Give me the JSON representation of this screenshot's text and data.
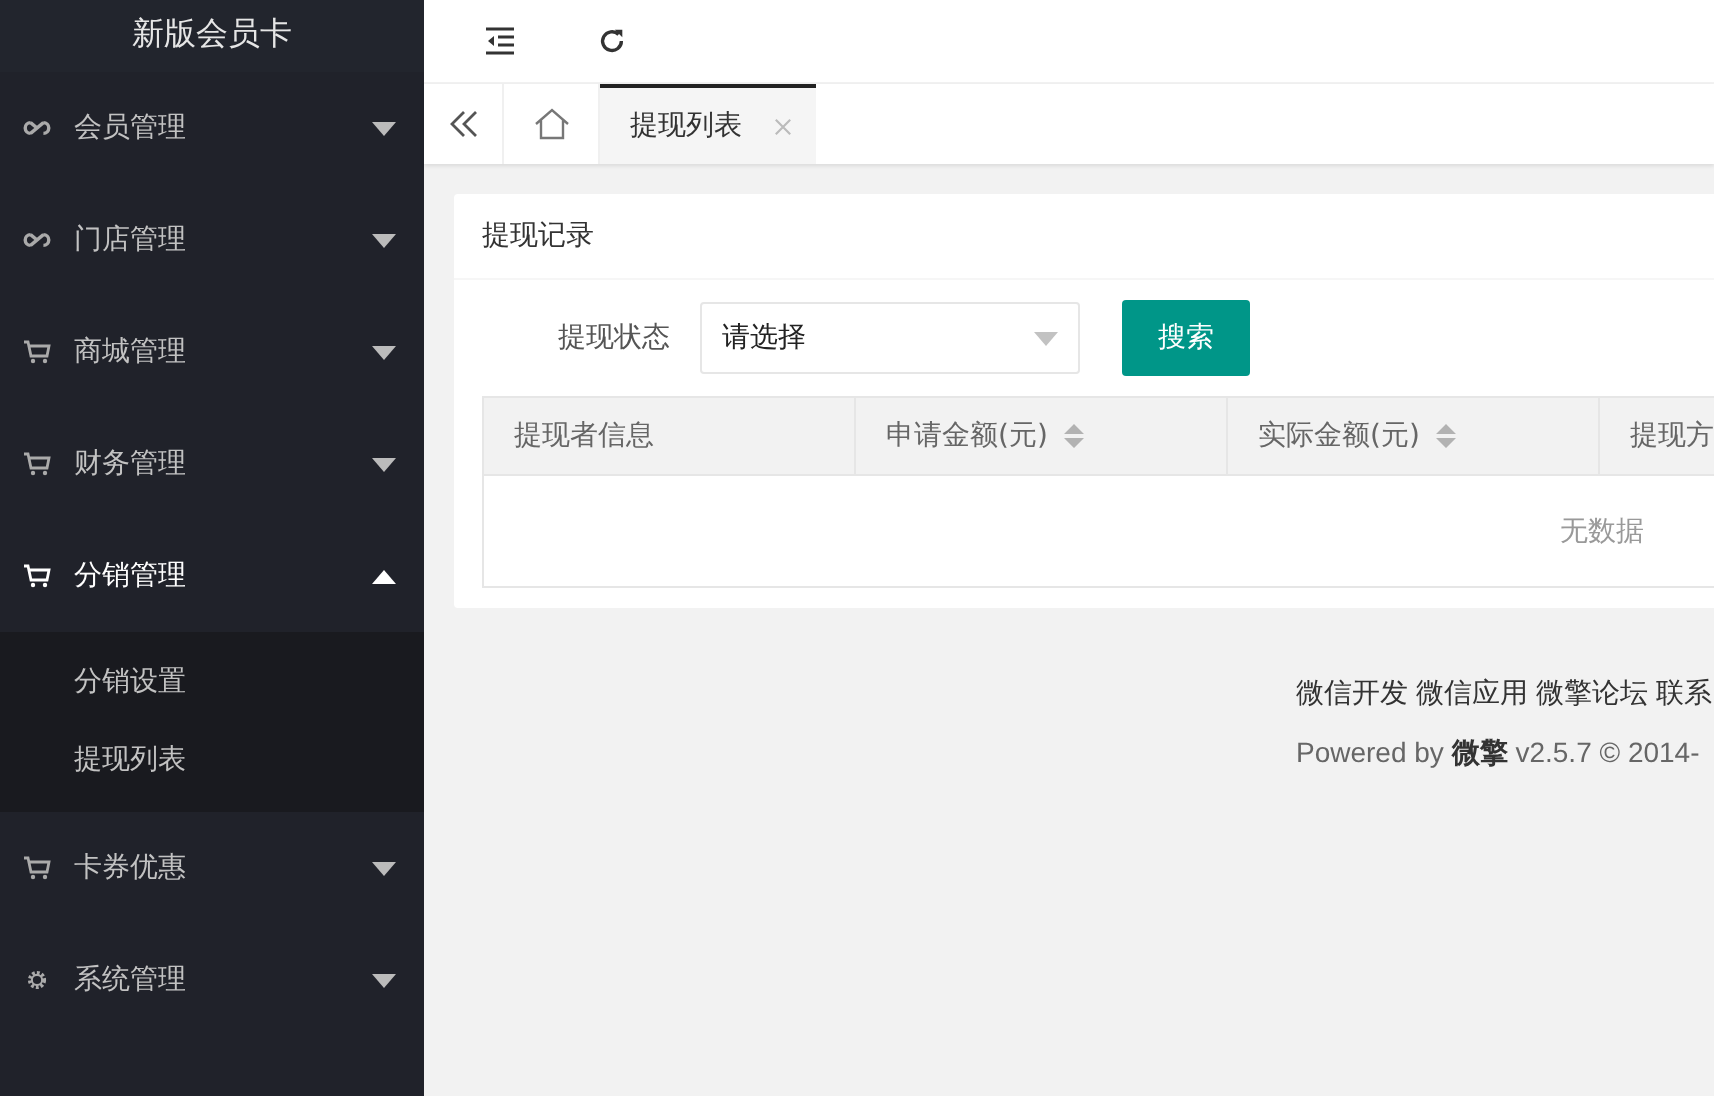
{
  "sidebar": {
    "title": "新版会员卡",
    "items": [
      {
        "kind": "link",
        "label": "会员管理",
        "expanded": false
      },
      {
        "kind": "link",
        "label": "门店管理",
        "expanded": false
      },
      {
        "kind": "cart",
        "label": "商城管理",
        "expanded": false
      },
      {
        "kind": "cart",
        "label": "财务管理",
        "expanded": false
      },
      {
        "kind": "cart",
        "label": "分销管理",
        "expanded": true,
        "children": [
          {
            "label": "分销设置"
          },
          {
            "label": "提现列表"
          }
        ]
      },
      {
        "kind": "cart",
        "label": "卡券优惠",
        "expanded": false
      },
      {
        "kind": "gear",
        "label": "系统管理",
        "expanded": false
      }
    ]
  },
  "tabs": [
    {
      "label": "提现列表",
      "selected": true
    }
  ],
  "card": {
    "title": "提现记录",
    "filter": {
      "label": "提现状态",
      "placeholder": "请选择"
    },
    "search_button": "搜索",
    "table": {
      "columns": [
        {
          "label": "提现者信息",
          "sortable": false
        },
        {
          "label": "申请金额(元)",
          "sortable": true
        },
        {
          "label": "实际金额(元)",
          "sortable": true
        },
        {
          "label": "提现方",
          "sortable": false
        }
      ],
      "empty_text": "无数据"
    }
  },
  "footer": {
    "links": [
      "微信开发",
      "微信应用",
      "微擎论坛",
      "联系"
    ],
    "powered_prefix": "Powered by",
    "brand": "微擎",
    "version": "v2.5.7 © 2014-"
  }
}
